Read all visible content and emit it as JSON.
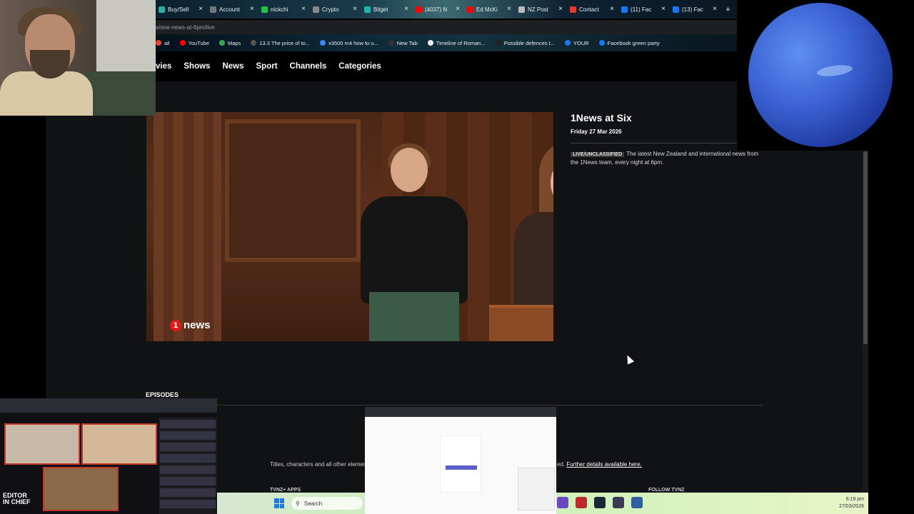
{
  "browser": {
    "tabs": [
      {
        "label": "Buy/Sell",
        "color": "#2ab0a0"
      },
      {
        "label": "Account",
        "color": "#777777"
      },
      {
        "label": "nickchi",
        "color": "#25c245"
      },
      {
        "label": "Crypto",
        "color": "#888888"
      },
      {
        "label": "Bitget",
        "color": "#1bb6b0"
      },
      {
        "label": "(4037) N",
        "color": "#ff0000"
      },
      {
        "label": "Ed McKi",
        "color": "#ff0000"
      },
      {
        "label": "NZ Post",
        "color": "#bbbbbb"
      },
      {
        "label": "Contact",
        "color": "#e23b2d"
      },
      {
        "label": "(11) Fac",
        "color": "#1877f2"
      },
      {
        "label": "(13) Fac",
        "color": "#1877f2"
      }
    ],
    "new_tab": "+",
    "close_glyph": "×",
    "url": "s/one-news-at-6pm/live",
    "bookmarks": [
      {
        "label": "ail",
        "color": "#ea4335"
      },
      {
        "label": "YouTube",
        "color": "#ff0000"
      },
      {
        "label": "Maps",
        "color": "#34a853"
      },
      {
        "label": "13.3 The price of to...",
        "color": "#555555"
      },
      {
        "label": "x3500 m4 how to u...",
        "color": "#4285f4"
      },
      {
        "label": "New Tab",
        "color": "#333333"
      },
      {
        "label": "Timeline of Roman...",
        "color": "#eeeeee"
      },
      {
        "label": "Possible defences t...",
        "color": "#222222"
      },
      {
        "label": "YOUR",
        "color": "#1877f2"
      },
      {
        "label": "Facebook green party",
        "color": "#1877f2"
      }
    ]
  },
  "nav": {
    "items": [
      "vies",
      "Shows",
      "News",
      "Sport",
      "Channels",
      "Categories"
    ]
  },
  "video": {
    "logo_number": "1",
    "logo_text": "news"
  },
  "program": {
    "title": "1News at Six",
    "date": "Friday 27 Mar 2026",
    "badge": "LIVE/UNCLASSIFIED",
    "description": "The latest New Zealand and international news from the 1News team, every night at 6pm."
  },
  "episodes_heading": "EPISODES",
  "footer": {
    "text_left": "Titles, characters and all other element",
    "text_right_prefix": "ed.",
    "link": "Further details available here.",
    "apps_heading": "TVNZ+ APPS",
    "follow_heading": "FOLLOW TVNZ"
  },
  "overlay": {
    "editor_badge_line1": "EDITOR",
    "editor_badge_line2": "IN CHIEF"
  },
  "taskbar": {
    "search_label": "Search",
    "time": "6:19 pm",
    "date": "27/03/2026",
    "icon_colors": [
      "#6a4ac0",
      "#c0292b",
      "#1b2838",
      "#3a3a55",
      "#2f5fa0"
    ]
  }
}
